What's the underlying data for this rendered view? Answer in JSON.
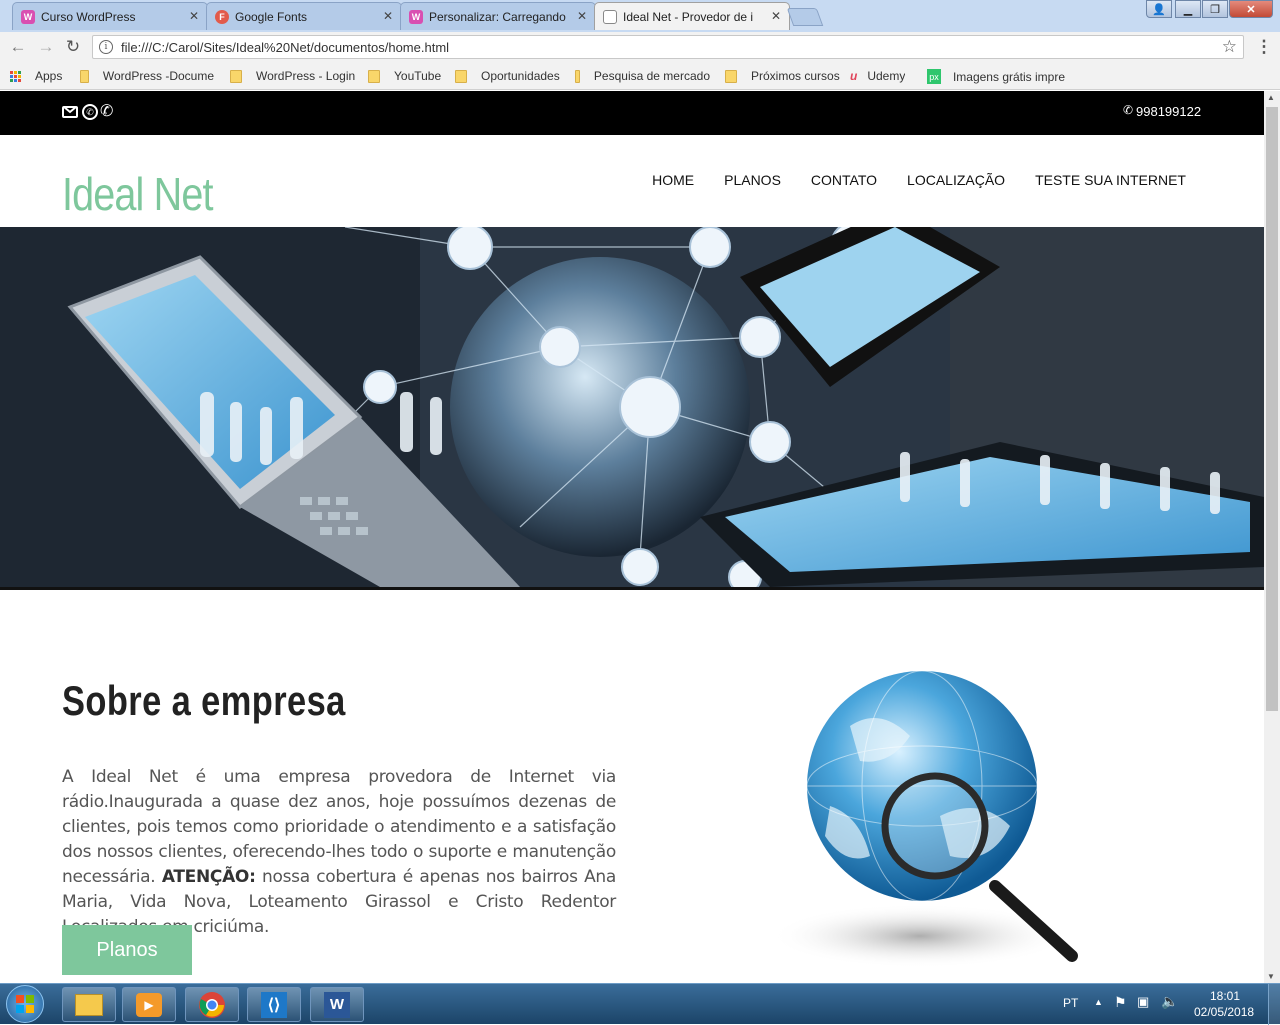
{
  "browser": {
    "tabs": [
      {
        "title": "Curso WordPress",
        "favicon": "W",
        "favicon_color": "#d94fb1"
      },
      {
        "title": "Google Fonts",
        "favicon": "F",
        "favicon_color": "#e25b4b"
      },
      {
        "title": "Personalizar: Carregando",
        "favicon": "W",
        "favicon_color": "#d94fb1"
      },
      {
        "title": "Ideal Net - Provedor de i",
        "favicon": "",
        "favicon_color": "#ffffff"
      }
    ],
    "url": "file:///C:/Carol/Sites/Ideal%20Net/documentos/home.html",
    "bookmarks": [
      {
        "label": "Apps"
      },
      {
        "label": "WordPress -Docume"
      },
      {
        "label": "WordPress - Login"
      },
      {
        "label": "YouTube"
      },
      {
        "label": "Oportunidades"
      },
      {
        "label": "Pesquisa de mercado"
      },
      {
        "label": "Próximos cursos"
      },
      {
        "label": "Udemy"
      },
      {
        "label": "Imagens grátis impre"
      }
    ]
  },
  "site": {
    "phone": "998199122",
    "logo": "Ideal Net",
    "nav": [
      "HOME",
      "PLANOS",
      "CONTATO",
      "LOCALIZAÇÃO",
      "TESTE SUA INTERNET"
    ],
    "accent_color": "#7ec79c",
    "about": {
      "title": "Sobre a empresa",
      "text_before": "A Ideal Net é uma empresa provedora de Internet via rádio.Inaugurada a quase dez anos, hoje possuímos dezenas de clientes, pois temos como prioridade o atendimento e a satisfação dos nossos clientes, oferecendo-lhes todo o suporte e manutenção necessária.",
      "text_bold": "ATENÇÃO:",
      "text_after": "nossa cobertura é apenas nos bairros Ana Maria, Vida Nova, Loteamento Girassol e Cristo Redentor Localizados em criciúma.",
      "button": "Planos"
    }
  },
  "taskbar": {
    "lang": "PT",
    "time": "18:01",
    "date": "02/05/2018"
  }
}
